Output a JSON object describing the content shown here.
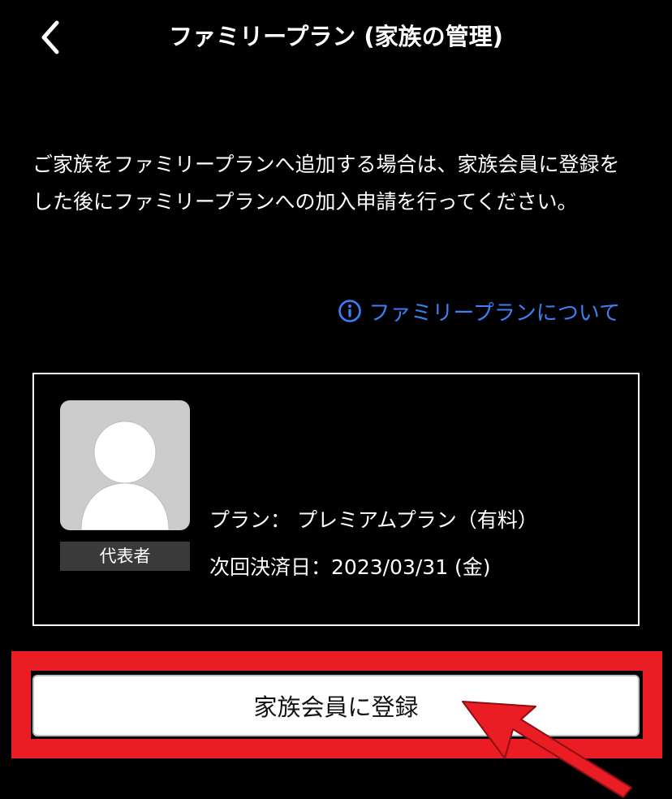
{
  "header": {
    "title": "ファミリープラン (家族の管理)"
  },
  "intro": {
    "text": "ご家族をファミリープランへ追加する場合は、家族会員に登録をした後にファミリープランへの加入申請を行ってください。"
  },
  "about_link": {
    "label": "ファミリープランについて"
  },
  "member": {
    "role": "代表者",
    "plan_label": "プラン：",
    "plan_value": "プレミアムプラン（有料）",
    "payment_label": "次回決済日：",
    "payment_value": "2023/03/31 (金)"
  },
  "register_button": {
    "label": "家族会員に登録"
  },
  "colors": {
    "background": "#000000",
    "link": "#3d7ff5",
    "highlight": "#ea1c24",
    "avatar_bg": "#cccccc",
    "badge_bg": "#3a3a3a"
  },
  "icons": {
    "back": "chevron-left-icon",
    "info": "info-circle-icon",
    "avatar": "person-silhouette-icon",
    "pointer": "red-arrow-icon"
  }
}
